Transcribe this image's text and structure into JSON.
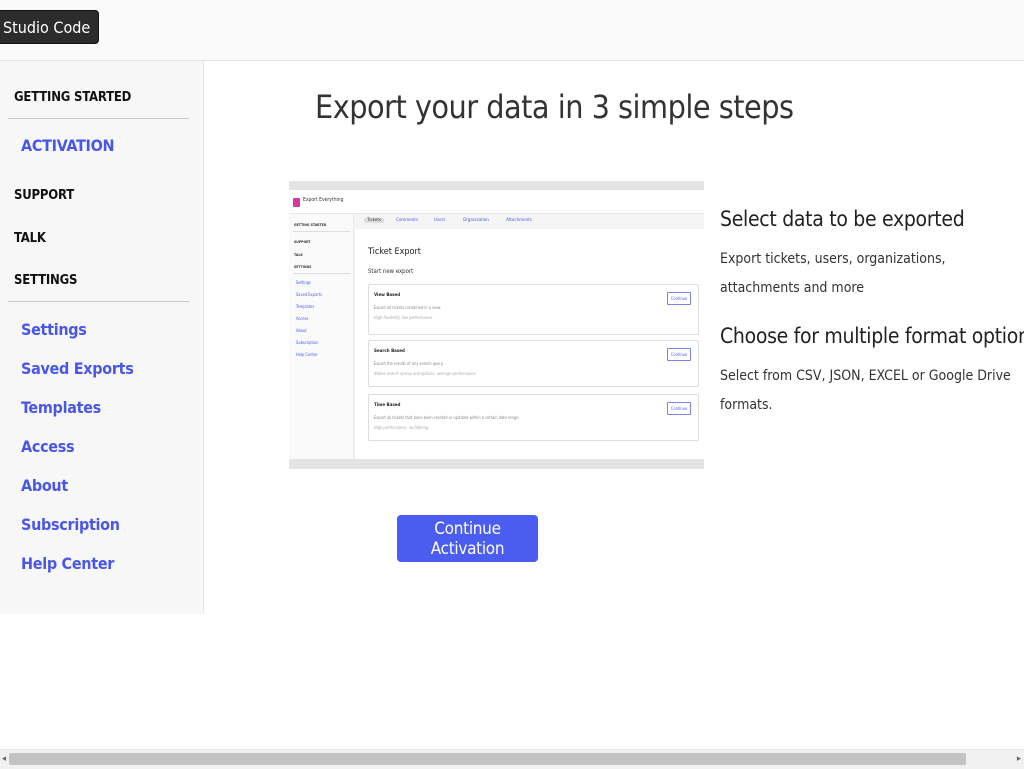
{
  "topbar": {
    "app_button": "Studio Code"
  },
  "sidebar": {
    "headings": [
      "GETTING STARTED",
      "SUPPORT",
      "TALK",
      "SETTINGS"
    ],
    "activation": "ACTIVATION",
    "settings_links": [
      "Settings",
      "Saved Exports",
      "Templates",
      "Access",
      "About",
      "Subscription",
      "Help Center"
    ]
  },
  "main": {
    "title": "Export your data in 3 simple steps",
    "cta_label": "Continue Activation"
  },
  "preview": {
    "app_name": "Export Everything",
    "side_headings": [
      "GETTING STARTED",
      "SUPPORT",
      "TALK",
      "SETTINGS"
    ],
    "side_links": [
      "Settings",
      "Saved Exports",
      "Templates",
      "Access",
      "About",
      "Subscription",
      "Help Center"
    ],
    "tabs": [
      "Tickets",
      "Comments",
      "Users",
      "Organization",
      "Attachments"
    ],
    "title": "Ticket Export",
    "subtitle": "Start new export",
    "cards": [
      {
        "title": "View Based",
        "desc": "Export all tickets contained in a view.",
        "note": "High flexibility, low performance",
        "button": "Continue"
      },
      {
        "title": "Search Based",
        "desc": "Export the results of any search query.",
        "note": "Native search syntax and options, average performance",
        "button": "Continue"
      },
      {
        "title": "Time Based",
        "desc": "Export all tickets that have been created or updated within a certain date range.",
        "note": "High performance, no filtering",
        "button": "Continue"
      }
    ]
  },
  "features": [
    {
      "title": "Select data to be exported",
      "text": "Export tickets, users, organizations, attachments and more"
    },
    {
      "title": "Choose for multiple format option",
      "text": "Select from CSV, JSON, EXCEL or Google Drive formats."
    }
  ],
  "scrollbar": {
    "left_arrow": "◂",
    "right_arrow": "▸"
  }
}
